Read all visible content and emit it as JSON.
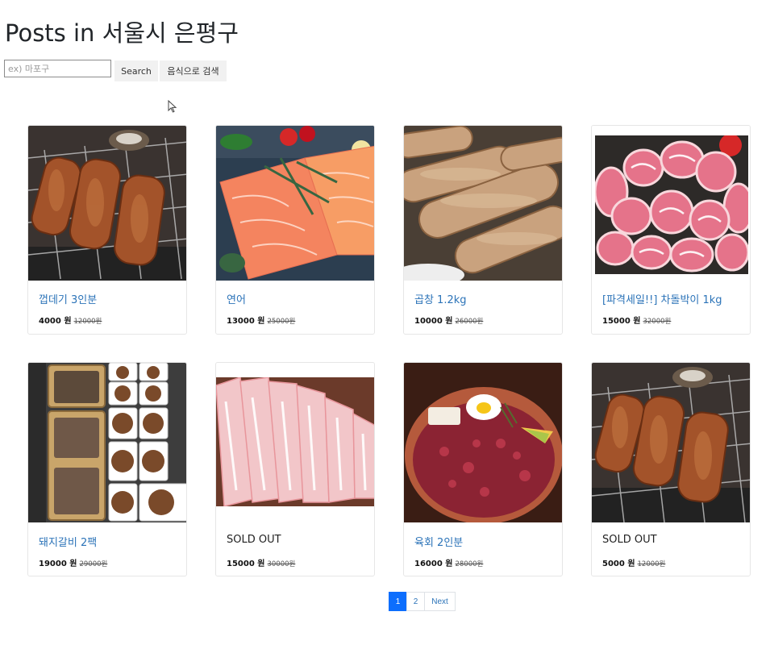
{
  "header": {
    "title": "Posts in 서울시 은평구"
  },
  "search": {
    "placeholder": "ex) 마포구",
    "search_label": "Search",
    "food_search_label": "음식으로 검색"
  },
  "cursor": {
    "icon": "arrow-cursor-icon"
  },
  "colors": {
    "link": "#2b73b8",
    "active_page": "#0d6efd"
  },
  "posts": [
    {
      "name": "껍데기 3인분",
      "price": "4000 원",
      "original_price": "12000원",
      "image": "pork-skin-grill"
    },
    {
      "name": "연어",
      "price": "13000 원",
      "original_price": "25000원",
      "image": "salmon"
    },
    {
      "name": "곱창 1.2kg",
      "price": "10000 원",
      "original_price": "26000원",
      "image": "gopchang"
    },
    {
      "name": "[파격세일!!] 차돌박이 1kg",
      "price": "15000 원",
      "original_price": "32000원",
      "image": "beef-brisket-rolls"
    },
    {
      "name": "돼지갈비 2팩",
      "price": "19000 원",
      "original_price": "29000원",
      "image": "galbi-packs"
    },
    {
      "name": "SOLD OUT",
      "price": "15000 원",
      "original_price": "30000원",
      "image": "pork-belly"
    },
    {
      "name": "육회 2인분",
      "price": "16000 원",
      "original_price": "28000원",
      "image": "yukhoe"
    },
    {
      "name": "SOLD OUT",
      "price": "5000 원",
      "original_price": "12000원",
      "image": "pork-skin-grill"
    }
  ],
  "pagination": {
    "pages": [
      "1",
      "2"
    ],
    "next_label": "Next",
    "current": "1"
  }
}
